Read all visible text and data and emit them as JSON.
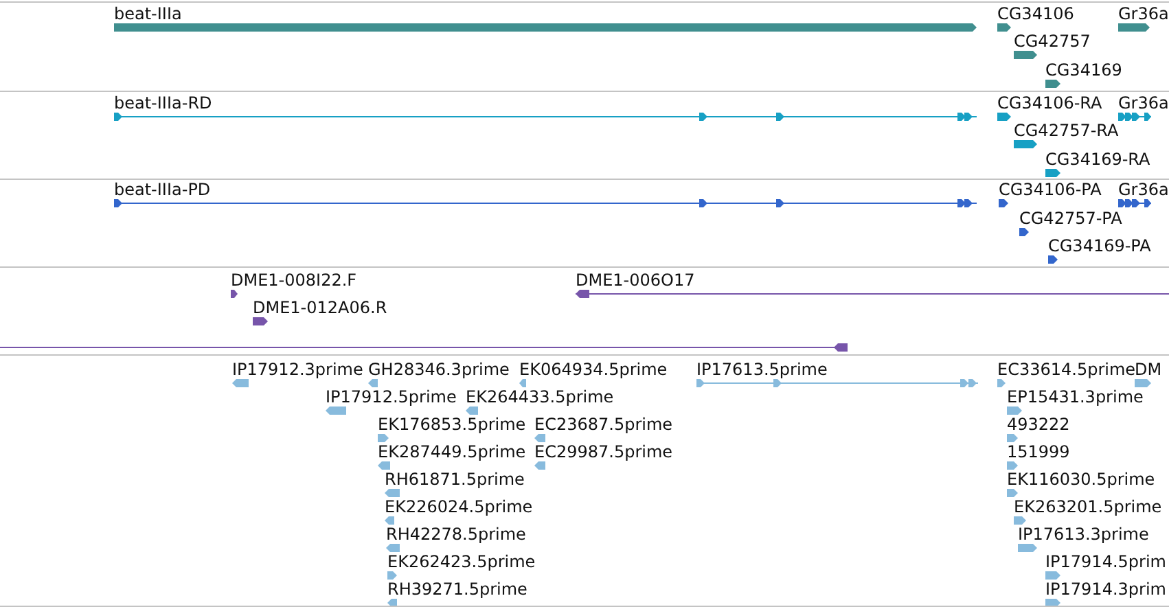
{
  "tracks": [
    {
      "color": "#408f8f",
      "features": [
        {
          "label": "beat-IIIa",
          "kind": "gene",
          "reverse": false
        },
        {
          "label": "CG34106",
          "kind": "gene",
          "reverse": false
        },
        {
          "label": "Gr36a",
          "kind": "gene",
          "reverse": false
        },
        {
          "label": "CG42757",
          "kind": "gene",
          "reverse": false
        },
        {
          "label": "CG34169",
          "kind": "gene",
          "reverse": false
        }
      ]
    },
    {
      "color": "#17a0c4",
      "features": [
        {
          "label": "beat-IIIa-RD",
          "kind": "transcript",
          "reverse": false
        },
        {
          "label": "CG34106-RA",
          "kind": "gene",
          "reverse": false
        },
        {
          "label": "Gr36a",
          "kind": "transcript",
          "reverse": false
        },
        {
          "label": "CG42757-RA",
          "kind": "gene",
          "reverse": false
        },
        {
          "label": "CG34169-RA",
          "kind": "gene",
          "reverse": false
        }
      ]
    },
    {
      "color": "#3366cc",
      "features": [
        {
          "label": "beat-IIIa-PD",
          "kind": "transcript",
          "reverse": false
        },
        {
          "label": "CG34106-PA",
          "kind": "gene",
          "reverse": false
        },
        {
          "label": "Gr36a",
          "kind": "transcript",
          "reverse": false
        },
        {
          "label": "CG42757-PA",
          "kind": "gene",
          "reverse": false
        },
        {
          "label": "CG34169-PA",
          "kind": "gene",
          "reverse": false
        }
      ]
    },
    {
      "color": "#7755aa",
      "features": [
        {
          "label": "DME1-008I22.F",
          "kind": "gene",
          "reverse": false
        },
        {
          "label": "DME1-012A06.R",
          "kind": "gene",
          "reverse": false
        },
        {
          "label": "DME1-006O17",
          "kind": "transcript",
          "reverse": true
        },
        {
          "kind": "transcript",
          "reverse": true
        }
      ]
    },
    {
      "color": "#88bbdd",
      "features": [
        {
          "label": "IP17912.3prime",
          "kind": "gene",
          "reverse": true
        },
        {
          "label": "GH28346.3prime",
          "kind": "gene",
          "reverse": true
        },
        {
          "label": "EK064934.5prime",
          "kind": "gene",
          "reverse": true
        },
        {
          "label": "IP17613.5prime",
          "kind": "transcript",
          "reverse": false
        },
        {
          "label": "EC33614.5prime",
          "kind": "gene",
          "reverse": false
        },
        {
          "label": "DM",
          "kind": "gene",
          "reverse": false
        },
        {
          "label": "IP17912.5prime",
          "kind": "gene",
          "reverse": true
        },
        {
          "label": "EK264433.5prime",
          "kind": "gene",
          "reverse": true
        },
        {
          "label": "EP15431.3prime",
          "kind": "gene",
          "reverse": false
        },
        {
          "label": "EK176853.5prime",
          "kind": "gene",
          "reverse": false
        },
        {
          "label": "EC23687.5prime",
          "kind": "gene",
          "reverse": true
        },
        {
          "label": "493222",
          "kind": "gene",
          "reverse": false
        },
        {
          "label": "EK287449.5prime",
          "kind": "gene",
          "reverse": true
        },
        {
          "label": "EC29987.5prime",
          "kind": "gene",
          "reverse": true
        },
        {
          "label": "151999",
          "kind": "gene",
          "reverse": false
        },
        {
          "label": "RH61871.5prime",
          "kind": "gene",
          "reverse": true
        },
        {
          "label": "EK116030.5prime",
          "kind": "gene",
          "reverse": false
        },
        {
          "label": "EK226024.5prime",
          "kind": "gene",
          "reverse": true
        },
        {
          "label": "EK263201.5prime",
          "kind": "gene",
          "reverse": false
        },
        {
          "label": "RH42278.5prime",
          "kind": "gene",
          "reverse": true
        },
        {
          "label": "IP17613.3prime",
          "kind": "gene",
          "reverse": false
        },
        {
          "label": "EK262423.5prime",
          "kind": "gene",
          "reverse": false
        },
        {
          "label": "IP17914.5prim",
          "kind": "gene",
          "reverse": false
        },
        {
          "label": "RH39271.5prime",
          "kind": "gene",
          "reverse": true
        },
        {
          "label": "IP17914.3prim",
          "kind": "gene",
          "reverse": false
        }
      ]
    }
  ]
}
